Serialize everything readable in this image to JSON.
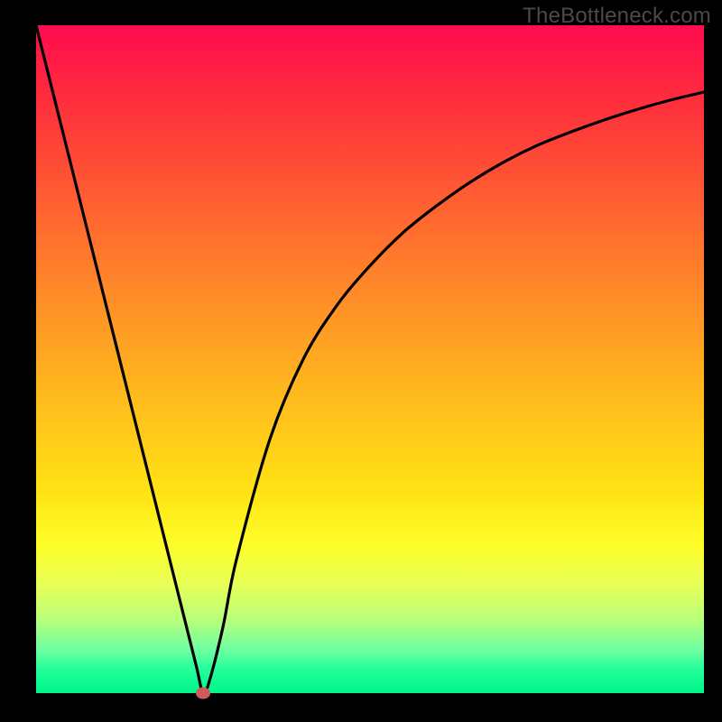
{
  "watermark": "TheBottleneck.com",
  "colors": {
    "frame_bg": "#000000",
    "gradient_top": "#ff0b4f",
    "gradient_bottom": "#00f58a",
    "curve": "#000000",
    "marker": "#d05a5a"
  },
  "chart_data": {
    "type": "line",
    "title": "",
    "xlabel": "",
    "ylabel": "",
    "xlim": [
      0,
      100
    ],
    "ylim": [
      0,
      100
    ],
    "x": [
      0,
      5,
      10,
      15,
      20,
      22,
      24,
      25,
      26,
      28,
      30,
      35,
      40,
      45,
      50,
      55,
      60,
      65,
      70,
      75,
      80,
      85,
      90,
      95,
      100
    ],
    "values": [
      100,
      80,
      60,
      40,
      20,
      12,
      4,
      0,
      2,
      10,
      20,
      38,
      50,
      58,
      64,
      69,
      73,
      76.5,
      79.5,
      82,
      84,
      85.8,
      87.4,
      88.8,
      90
    ],
    "marker": {
      "x": 25,
      "y": 0
    },
    "annotations": []
  }
}
